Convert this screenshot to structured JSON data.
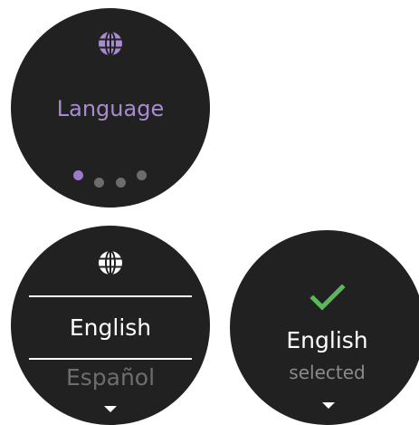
{
  "screen_language_intro": {
    "title": "Language",
    "icon": "globe-icon",
    "accent_color": "#a98bd1",
    "page_indicator": {
      "total": 4,
      "active_index": 0
    }
  },
  "screen_language_picker": {
    "icon": "globe-icon",
    "selected_option": "English",
    "next_option": "Español",
    "more_indicator": "chevron-down-icon"
  },
  "screen_confirmation": {
    "icon": "check-icon",
    "check_color": "#5cb85c",
    "language": "English",
    "status": "selected",
    "more_indicator": "chevron-down-icon"
  }
}
